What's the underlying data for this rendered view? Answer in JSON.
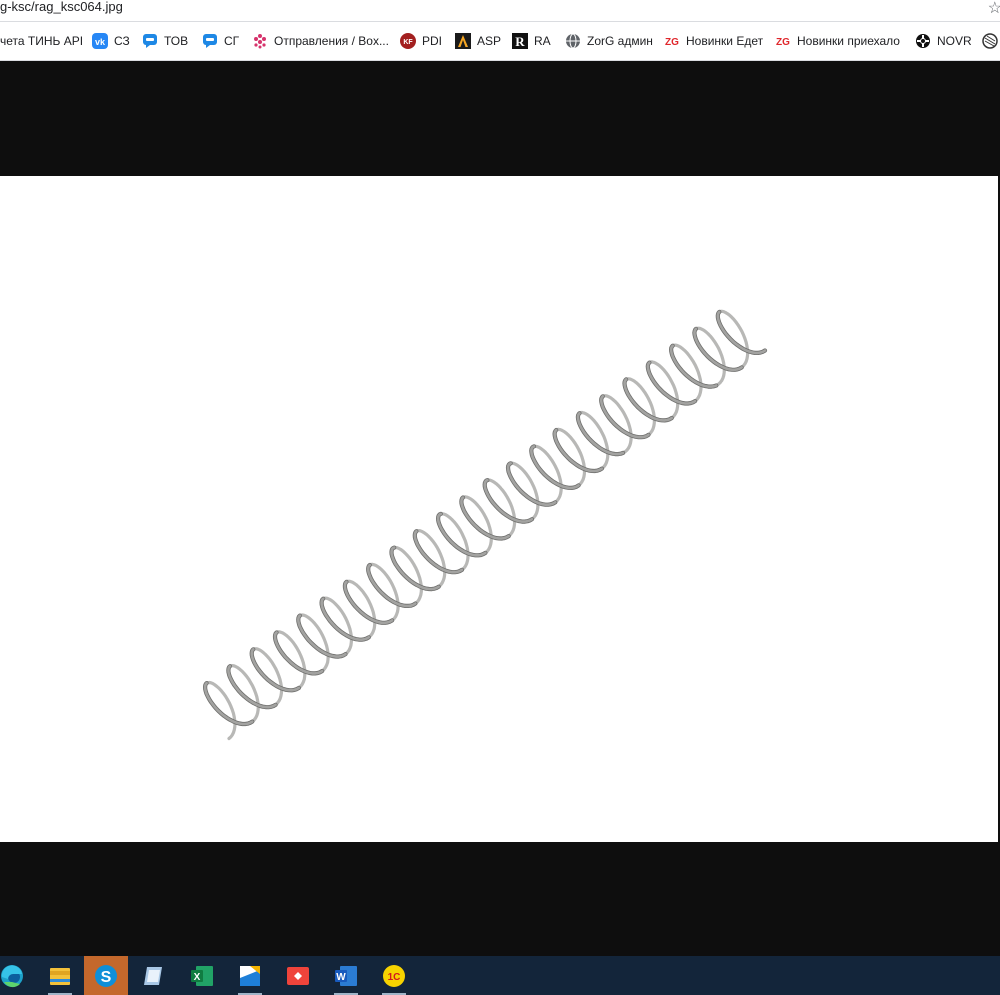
{
  "browser": {
    "url": "g-ksc/rag_ksc064.jpg",
    "bookmarks": [
      {
        "label": "чета ТИНЬ API",
        "icon": "none"
      },
      {
        "label": "СЗ",
        "icon": "vk-icon"
      },
      {
        "label": "ТОВ",
        "icon": "chat-bubble-icon"
      },
      {
        "label": "СГ",
        "icon": "chat-bubble-icon"
      },
      {
        "label": "Отправления / Box...",
        "icon": "boxberry-icon"
      },
      {
        "label": "PDI",
        "icon": "pdi-icon"
      },
      {
        "label": "ASP",
        "icon": "asp-icon"
      },
      {
        "label": "RA",
        "icon": "ra-icon"
      },
      {
        "label": "ZorG админ",
        "icon": "globe-icon"
      },
      {
        "label": "Новинки Едет",
        "icon": "zg-icon"
      },
      {
        "label": "Новинки приехало",
        "icon": "zg-icon"
      },
      {
        "label": "NOVR",
        "icon": "novr-icon"
      }
    ]
  },
  "image": {
    "filename": "rag_ksc064.jpg",
    "subject": "spring"
  },
  "taskbar": {
    "apps": [
      "edge-icon",
      "file-explorer-icon",
      "skype-icon",
      "notes-icon",
      "excel-icon",
      "app-icon",
      "anydesk-icon",
      "word-icon",
      "1c-icon"
    ],
    "active": "skype-icon"
  },
  "colors": {
    "viewer_bg": "#0e0e0e",
    "taskbar_bg": "#13253a",
    "spring": "#9a9a98"
  }
}
